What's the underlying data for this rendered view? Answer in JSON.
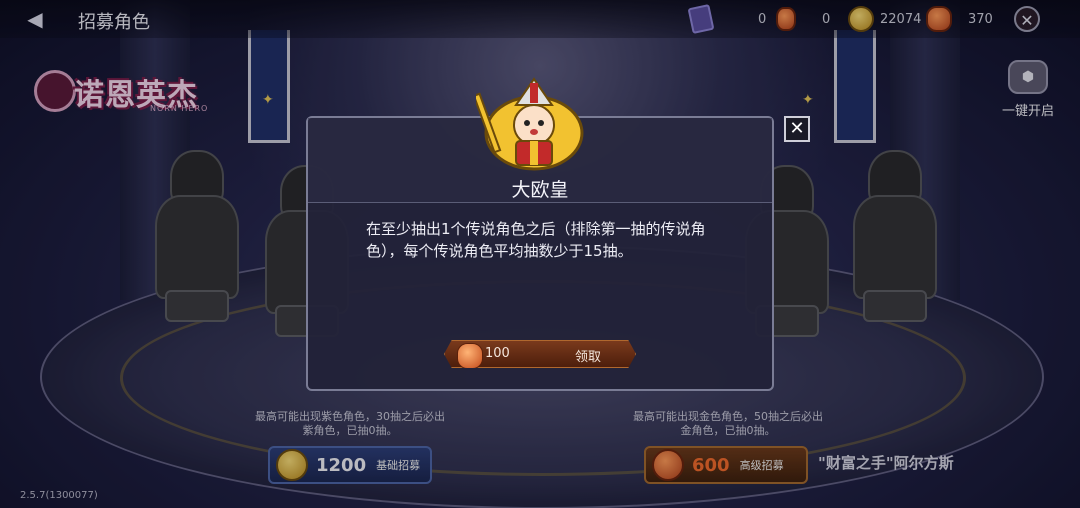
{
  "topbar": {
    "title": "招募角色",
    "ticket_count": "0",
    "gem_small_count": "0",
    "coins": "22074",
    "gems": "370"
  },
  "logo": {
    "text": "诺恩英杰",
    "subtext": "NORN HERO"
  },
  "side": {
    "one_key_label": "一键开启"
  },
  "modal": {
    "achievement_title": "大欧皇",
    "description": "在至少抽出1个传说角色之后（排除第一抽的传说角色），每个传说角色平均抽数少于15抽。",
    "reward_amount": "100",
    "claim_label": "领取"
  },
  "recruit": {
    "basic": {
      "info": "最高可能出现紫色角色，30抽之后必出紫角色，已抽0抽。",
      "count": "1200",
      "label": "基础招募"
    },
    "advanced": {
      "info": "最高可能出现金色角色，50抽之后必出金角色，已抽0抽。",
      "count": "600",
      "label": "高级招募"
    },
    "featured_hero": "\"财富之手\"阿尔方斯"
  },
  "version": "2.5.7(1300077)",
  "icons": {
    "back": "back-arrow-icon",
    "close": "close-icon",
    "ticket": "ticket-icon",
    "coin": "coin-icon",
    "gem": "gem-icon",
    "chest": "chest-icon",
    "achievement": "bishop-avatar-icon"
  },
  "colors": {
    "modal_bg": "#222238",
    "claim_button": "#7a3a1c",
    "basic_button": "#2d3f7a",
    "advanced_button": "#6b3a1c",
    "coin": "#e0b23c",
    "gem": "#e0602a"
  }
}
